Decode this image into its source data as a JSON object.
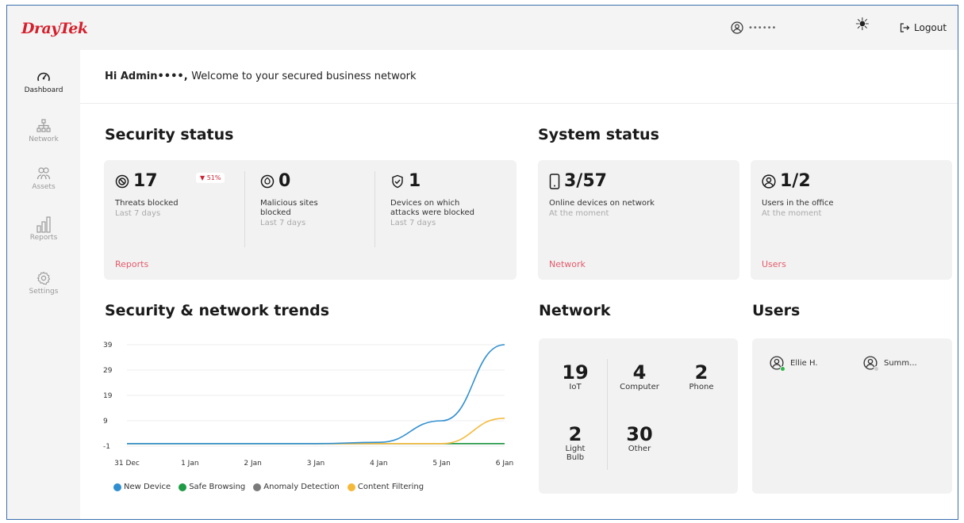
{
  "header": {
    "logo": "DrayTek",
    "user_name": "••••••",
    "logout_label": "Logout"
  },
  "sidebar": {
    "items": [
      {
        "label": "Dashboard",
        "icon": "gauge-icon",
        "active": true
      },
      {
        "label": "Network",
        "icon": "network-icon",
        "active": false
      },
      {
        "label": "Assets",
        "icon": "assets-icon",
        "active": false
      },
      {
        "label": "Reports",
        "icon": "bar-chart-icon",
        "active": false
      },
      {
        "label": "Settings",
        "icon": "gear-icon",
        "active": false
      }
    ]
  },
  "greeting": {
    "prefix": "Hi Admin",
    "name": "••••",
    "suffix": "Welcome to your secured business network"
  },
  "security_status": {
    "title": "Security status",
    "threats": {
      "value": "17",
      "label": "Threats blocked",
      "sub": "Last 7 days",
      "badge": "▼ 51%"
    },
    "malicious": {
      "value": "0",
      "label_1": "Malicious sites",
      "label_2": "blocked",
      "sub": "Last 7 days"
    },
    "devices": {
      "value": "1",
      "label_1": "Devices on which",
      "label_2": "attacks were blocked",
      "sub": "Last 7 days"
    },
    "link": "Reports"
  },
  "system_status": {
    "title": "System status",
    "online": {
      "value": "3/57",
      "label": "Online devices on network",
      "sub": "At the moment",
      "link": "Network"
    },
    "users": {
      "value": "1/2",
      "label": "Users in the office",
      "sub": "At the moment",
      "link": "Users"
    }
  },
  "trends": {
    "title": "Security & network trends"
  },
  "network": {
    "title": "Network",
    "cells": [
      {
        "value": "19",
        "label": "IoT"
      },
      {
        "value": "4",
        "label": "Computer"
      },
      {
        "value": "2",
        "label": "Phone"
      },
      {
        "value": "2",
        "label": "Light Bulb"
      },
      {
        "value": "30",
        "label": "Other"
      }
    ]
  },
  "users": {
    "title": "Users",
    "list": [
      {
        "name": "Ellie H.",
        "status_color": "#2db84a"
      },
      {
        "name": "Summ...",
        "status_color": "#cfcfcf"
      }
    ]
  },
  "chart_data": {
    "type": "line",
    "x": [
      "31 Dec",
      "1 Jan",
      "2 Jan",
      "3 Jan",
      "4 Jan",
      "5 Jan",
      "6 Jan"
    ],
    "y_ticks": [
      39,
      29,
      19,
      9,
      -1
    ],
    "ylim": [
      -1,
      39
    ],
    "grid": true,
    "legend_position": "bottom",
    "series": [
      {
        "name": "New Device",
        "color": "#2f8fd0",
        "values": [
          0,
          0,
          0,
          0,
          0.5,
          9,
          39
        ]
      },
      {
        "name": "Safe Browsing",
        "color": "#1f9a45",
        "values": [
          0,
          0,
          0,
          0,
          0,
          0,
          0
        ]
      },
      {
        "name": "Anomaly Detection",
        "color": "#7a7a7a",
        "values": [
          0,
          0,
          0,
          0,
          0,
          0,
          0
        ]
      },
      {
        "name": "Content Filtering",
        "color": "#f5b93a",
        "values": [
          0,
          0,
          0,
          0,
          0,
          0,
          10
        ]
      }
    ]
  }
}
